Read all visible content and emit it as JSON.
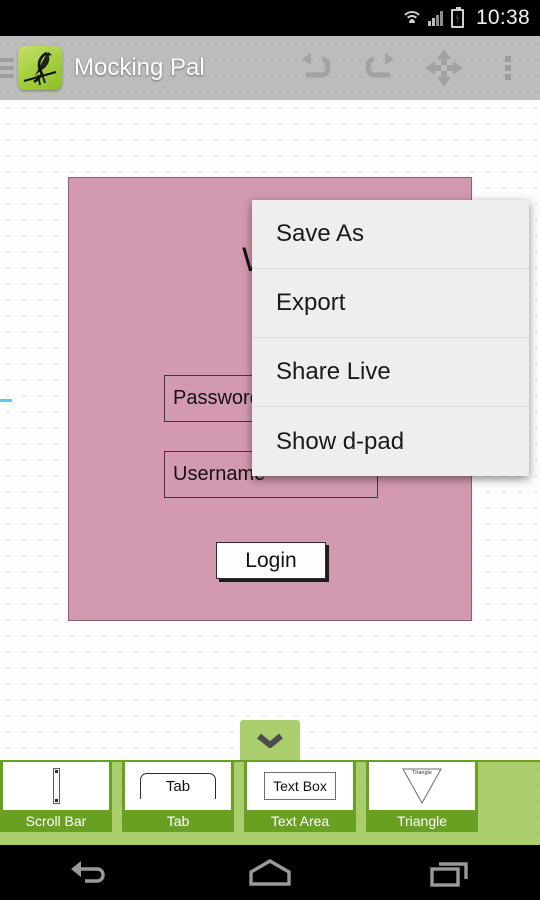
{
  "status_bar": {
    "time": "10:38",
    "icons": [
      "wifi-icon",
      "cellular-signal-icon",
      "battery-charging-icon"
    ]
  },
  "app_bar": {
    "title": "Mocking Pal",
    "menu_icon": "hamburger-icon",
    "logo_icon": "mockingbird-logo-icon",
    "buttons": [
      {
        "name": "undo-button",
        "icon": "undo-icon"
      },
      {
        "name": "redo-button",
        "icon": "redo-icon"
      },
      {
        "name": "dpad-button",
        "icon": "move-dpad-icon"
      },
      {
        "name": "overflow-button",
        "icon": "more-vertical-icon"
      }
    ]
  },
  "overflow_menu": {
    "items": [
      {
        "label": "Save As"
      },
      {
        "label": "Export"
      },
      {
        "label": "Share Live"
      },
      {
        "label": "Show d-pad"
      }
    ]
  },
  "canvas": {
    "mockup": {
      "title": "Wel",
      "fields": [
        {
          "name": "password-field",
          "value": "Password"
        },
        {
          "name": "username-field",
          "value": "Username"
        }
      ],
      "button": {
        "label": "Login"
      },
      "panel_color": "#d399b0"
    }
  },
  "palette": {
    "collapse_icon": "chevron-down-icon",
    "items": [
      {
        "label": "Scroll Bar",
        "thumb": "scrollbar-icon",
        "thumb_text": ""
      },
      {
        "label": "Tab",
        "thumb": "tab-icon",
        "thumb_text": "Tab"
      },
      {
        "label": "Text Area",
        "thumb": "textbox-icon",
        "thumb_text": "Text Box"
      },
      {
        "label": "Triangle",
        "thumb": "triangle-icon",
        "thumb_text": "Triangle"
      }
    ]
  },
  "nav_bar": {
    "buttons": [
      {
        "name": "back-button",
        "icon": "back-arrow-icon"
      },
      {
        "name": "home-button",
        "icon": "home-icon"
      },
      {
        "name": "recents-button",
        "icon": "recents-icon"
      }
    ]
  },
  "colors": {
    "accent_green": "#6aa021",
    "palette_bg": "#aacd6e",
    "mockup_pink": "#d399b0",
    "appbar_gray": "#bcbcbc"
  }
}
